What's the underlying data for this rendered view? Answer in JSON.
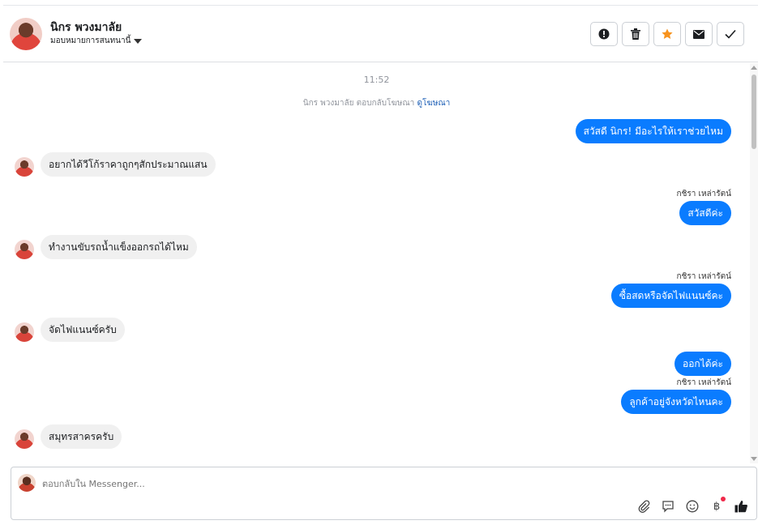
{
  "header": {
    "contact_name": "นิกร พวงมาลัย",
    "assign_label": "มอบหมายการสนทนานี้",
    "actions": [
      {
        "icon": "alert-icon",
        "glyph": "!"
      },
      {
        "icon": "trash-icon",
        "glyph": "🗑"
      },
      {
        "icon": "star-icon",
        "glyph": "★",
        "color": "#f7931e"
      },
      {
        "icon": "envelope-icon",
        "glyph": "✉"
      },
      {
        "icon": "check-icon",
        "glyph": "✓"
      }
    ]
  },
  "thread": {
    "timestamp": "11:52",
    "system_message": "นิกร พวงมาลัย ตอบกลับโฆษณา",
    "system_link": "ดูโฆษณา",
    "messages": [
      {
        "dir": "out",
        "text": "สวัสดี นิกร! มีอะไรให้เราช่วยไหม"
      },
      {
        "dir": "in",
        "text": "อยากได้วีโก้ราคาถูกๆสักประมาณแสน"
      },
      {
        "dir": "out",
        "sender": "กชิรา เหล่ารัตน์",
        "text": "สวัสดีค่ะ"
      },
      {
        "dir": "in",
        "text": "ทำงานขับรถน้ำแข็งออกรถได้ไหม"
      },
      {
        "dir": "out",
        "sender": "กชิรา เหล่ารัตน์",
        "text": "ซื้อสดหรือจัดไฟแนนซ์คะ"
      },
      {
        "dir": "in",
        "text": "จัดไฟแนนซ์ครับ"
      },
      {
        "dir": "out",
        "text": "ออกได้ค่ะ"
      },
      {
        "dir": "out",
        "sender": "กชิรา เหล่ารัตน์",
        "text": "ลูกค้าอยู่จังหวัดไหนคะ"
      },
      {
        "dir": "in",
        "text": "สมุทรสาครครับ"
      }
    ]
  },
  "composer": {
    "placeholder": "ตอบกลับใน Messenger...",
    "tools": [
      "paperclip-icon",
      "quick-reply-icon",
      "emoji-icon",
      "baht-icon",
      "thumbs-up-icon"
    ]
  },
  "colors": {
    "outgoing_bubble": "#0a7cff",
    "incoming_bubble": "#f0f0f0",
    "star": "#f7931e"
  }
}
